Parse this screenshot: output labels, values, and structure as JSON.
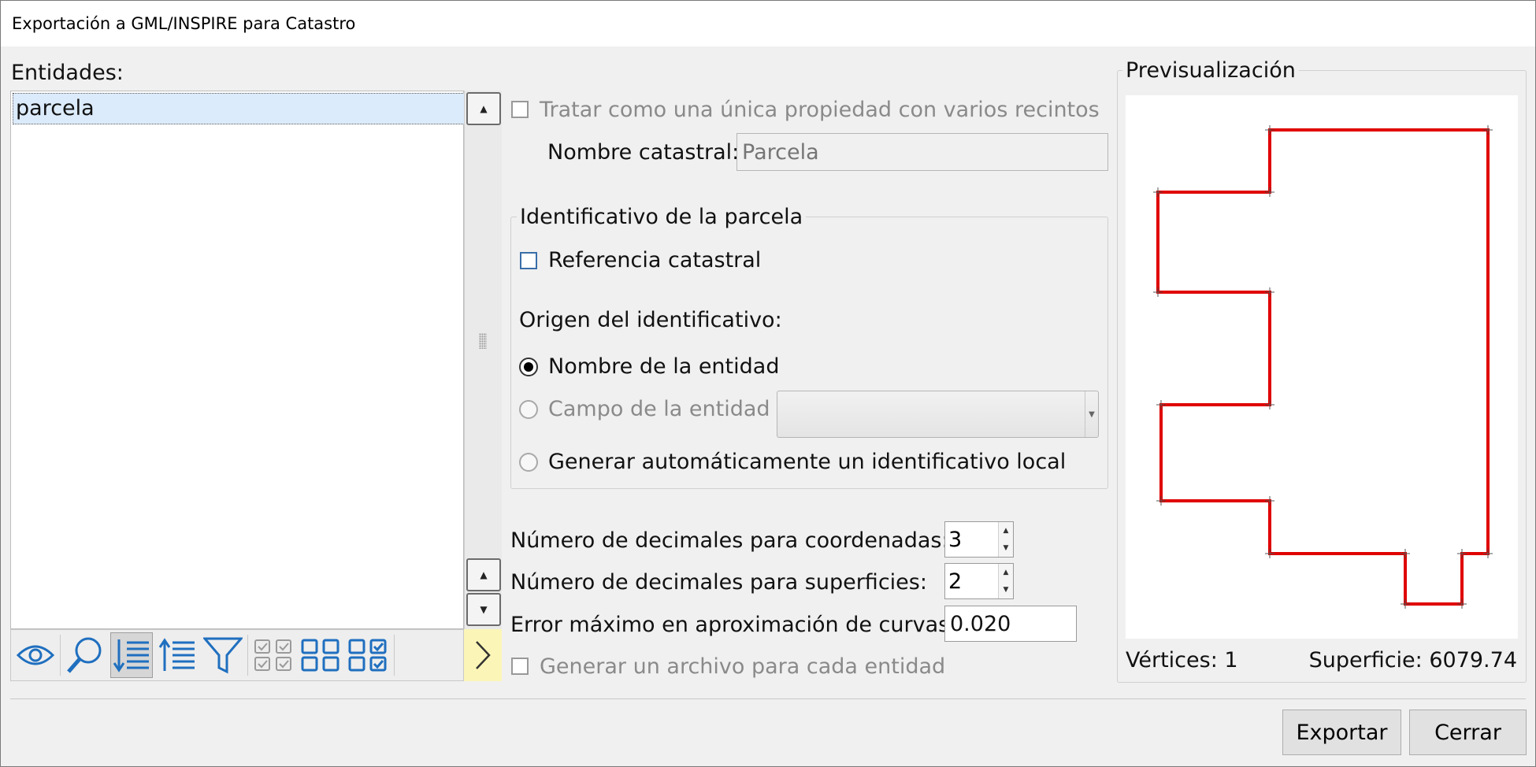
{
  "window": {
    "title": "Exportación a GML/INSPIRE para Catastro"
  },
  "entities": {
    "label": "Entidades:",
    "items": [
      "parcela"
    ]
  },
  "toolbar": {
    "icons": [
      "eye-icon",
      "zoom-icon",
      "sort-descending-icon",
      "sort-ascending-icon",
      "filter-icon",
      "check-all-icon",
      "uncheck-all-icon",
      "invert-check-icon"
    ]
  },
  "options": {
    "single_property_label": "Tratar como una única propiedad con varios recintos",
    "cadastral_name_label": "Nombre catastral:",
    "cadastral_name_placeholder": "Parcela"
  },
  "identifier_group": {
    "title": "Identificativo de la parcela",
    "cadastral_reference_label": "Referencia catastral",
    "origin_label": "Origen del identificativo:",
    "radio_entity_name": "Nombre de la entidad",
    "radio_entity_field": "Campo de la entidad",
    "radio_auto_generate": "Generar automáticamente un identificativo local"
  },
  "settings": {
    "coord_decimals_label": "Número de decimales para coordenadas:",
    "coord_decimals_value": "3",
    "area_decimals_label": "Número de decimales para superficies:",
    "area_decimals_value": "2",
    "max_error_label": "Error máximo en aproximación de curvas:",
    "max_error_value": "0.020",
    "file_per_entity_label": "Generar un archivo para cada entidad"
  },
  "preview": {
    "title": "Previsualización",
    "vertices_label": "Vértices: 1",
    "area_label": "Superficie: 6079.74",
    "polygon_color": "#e00000"
  },
  "buttons": {
    "export": "Exportar",
    "close": "Cerrar"
  }
}
